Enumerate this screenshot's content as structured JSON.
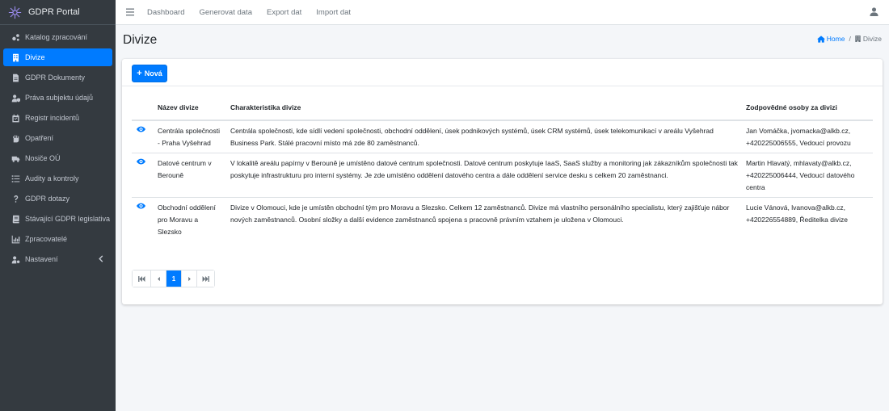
{
  "brand": {
    "title": "GDPR Portal",
    "accent": "#007bff"
  },
  "sidebar": {
    "items": [
      {
        "label": "Katalog zpracování",
        "icon": "cogs-icon"
      },
      {
        "label": "Divize",
        "icon": "building-icon",
        "active": true
      },
      {
        "label": "GDPR Dokumenty",
        "icon": "file-icon"
      },
      {
        "label": "Práva subjektu údajů",
        "icon": "user-shield-icon"
      },
      {
        "label": "Registr incidentů",
        "icon": "calendar-icon"
      },
      {
        "label": "Opatření",
        "icon": "hand-icon"
      },
      {
        "label": "Nosiče OÚ",
        "icon": "truck-icon"
      },
      {
        "label": "Audity a kontroly",
        "icon": "list-icon"
      },
      {
        "label": "GDPR dotazy",
        "icon": "question-icon"
      },
      {
        "label": "Stávající GDPR legislativa",
        "icon": "book-icon"
      },
      {
        "label": "Zpracovatelé",
        "icon": "chart-icon"
      },
      {
        "label": "Nastavení",
        "icon": "user-cog-icon"
      }
    ]
  },
  "topbar": {
    "links": [
      "Dashboard",
      "Generovat data",
      "Export dat",
      "Import dat"
    ]
  },
  "page": {
    "title": "Divize",
    "breadcrumb": {
      "home": "Home",
      "current": "Divize"
    }
  },
  "toolbar": {
    "new_label": "Nová"
  },
  "table": {
    "headers": [
      "Název divize",
      "Charakteristika divize",
      "Zodpovědné osoby za divizi"
    ],
    "rows": [
      {
        "name": "Centrála společnosti - Praha Vyšehrad",
        "description": "Centrála společnosti, kde sídlí vedení společnosti, obchodní oddělení, úsek podnikových systémů, úsek CRM systémů, úsek telekomunikací v areálu Vyšehrad Business Park. Stálé pracovní místo má zde 80 zaměstnanců.",
        "responsible": "Jan Vomáčka, jvomacka@alkb.cz, +420225006555, Vedoucí provozu"
      },
      {
        "name": "Datové centrum v Berouně",
        "description": "V lokalitě areálu papírny v Berouně je umístěno datové centrum společnosti. Datové centrum poskytuje IaaS, SaaS služby a monitoring jak zákazníkům společnosti tak poskytuje infrastrukturu pro interní systémy. Je zde umístěno oddělení datového centra a dále oddělení service desku s celkem 20 zaměstnanci.",
        "responsible": "Martin Hlavatý, mhlavaty@alkb.cz, +420225006444, Vedoucí datového centra"
      },
      {
        "name": "Obchodní oddělení pro Moravu a Slezsko",
        "description": "Divize v Olomouci, kde je umístěn obchodní tým pro Moravu a Slezsko. Celkem 12 zaměstnanců. Divize má vlastního personálního specialistu, který zajišťuje nábor nových zaměstnanců. Osobní složky a další evidence zaměstnanců spojena s pracovně právním vztahem je uložena v Olomouci.",
        "responsible": "Lucie Vánová, lvanova@alkb.cz, +420226554889, Ředitelka divize"
      }
    ]
  },
  "pagination": {
    "current_page": "1"
  }
}
